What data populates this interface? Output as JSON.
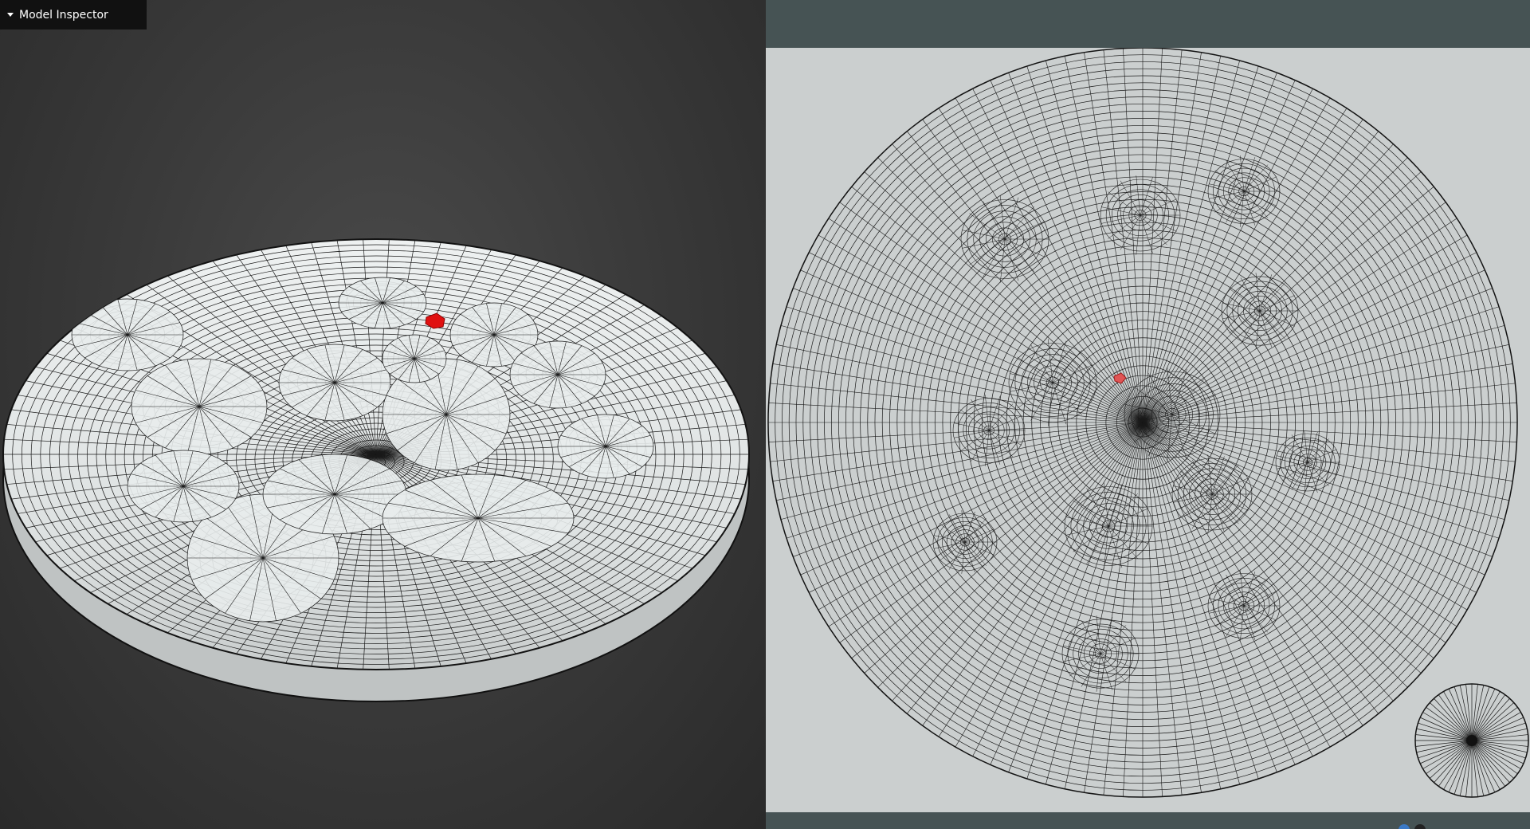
{
  "inspector": {
    "title": "Model Inspector",
    "expanded": true
  },
  "icons": {
    "collapse": "caret-down-icon",
    "selection": "selected-face-marker"
  },
  "colors": {
    "viewport_bg": "#3b3b3b",
    "mesh_fill": "#dfe3e3",
    "mesh_wire": "#1a1a1a",
    "selection": "#e01010",
    "uv_bg": "#cbcfcf",
    "panel_chrome": "#465354"
  }
}
